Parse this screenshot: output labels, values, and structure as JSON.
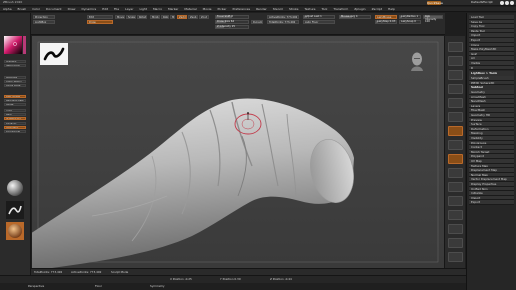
{
  "titlebar": {
    "app_title": "ZBrush 2020",
    "menus": [
      "Menus",
      "DefaultZScript"
    ],
    "quicksave": "QuickSave",
    "default_zscript": "DefaultZScript"
  },
  "menubar": {
    "items": [
      "Alpha",
      "Brush",
      "Color",
      "Document",
      "Draw",
      "Dynamics",
      "Edit",
      "File",
      "Layer",
      "Light",
      "Macro",
      "Marker",
      "Material",
      "Movie",
      "Picker",
      "Preferences",
      "Render",
      "Stencil",
      "Stroke",
      "Texture",
      "Tool",
      "Transform",
      "Zplugin",
      "Zscript",
      "Help"
    ]
  },
  "toolbar": {
    "projection": "Projection",
    "lightbox": "LightBox",
    "mrgb": "Mrgb",
    "rgb": "Rgb",
    "m": "M",
    "zadd": "Zadd",
    "zsub": "Zsub",
    "zcut": "Zcut",
    "focal_shift": "Focal Shift 0",
    "z_intensity": "Z Intensity 25",
    "draw_size": "Draw Size 64",
    "rgb_intensity": "Rgb Intensity 100",
    "dynamic": "Dynamic",
    "active_points": "ActivePoints: 773,492",
    "total_points": "TotalPoints: 773,492",
    "adjust_last": "Adjust Last 1",
    "auto_floor": "Auto Floor",
    "mouse_avg": "Mouse Avg 4",
    "lazy_mouse": "LazyMouse",
    "lazy_step": "LazyStep 0.03",
    "lazy_radius": "LazyRadius 1",
    "lazy_snap": "LazySnap 0",
    "edit": "Edit",
    "draw": "Draw",
    "move": "Move",
    "scale": "Scale",
    "rotate": "Rotate"
  },
  "leftshelf": {
    "labels": [
      "Alpha Off",
      "Texture Off",
      "Gradient",
      "SwitchColor",
      "Alternate",
      "Quick Sketch",
      "Curve Mode",
      "Lazy Mouse",
      "Backface Mask",
      "Xpose",
      "Front",
      "Back",
      "Sculptris Pro",
      "Dynamic",
      "Symmetry",
      "Edit Normal"
    ],
    "brush_label": "Standard",
    "stroke_label": "DragRect",
    "material_label": "MatCap Gray"
  },
  "rightnav": {
    "buttons": [
      "BPR",
      "SPix 3",
      "Scroll",
      "Zoom",
      "Actual",
      "AAHalf",
      "Persp",
      "Floor",
      "Local",
      "L.Sym",
      "Frame",
      "Move",
      "Zoom3D",
      "Rotate",
      "PolyF",
      "Transp",
      "Ghost",
      "Solo",
      "Xpose"
    ]
  },
  "tray": {
    "top_buttons": [
      "Load Tool",
      "Save As",
      "Copy Tool",
      "Paste Tool",
      "Import",
      "Export",
      "Clone",
      "Make PolyMesh3D",
      "GoZ",
      "All",
      "Visible",
      "R"
    ],
    "sections": [
      {
        "label": "Lightbox > Tools",
        "items": [
          "SimpleBrush",
          "PM3D_Sphere3D"
        ]
      },
      {
        "label": "Subtool",
        "items": [
          "Geometry",
          "ArrayMesh",
          "NanoMesh",
          "Layers",
          "FiberMesh",
          "Geometry HD",
          "Preview",
          "Surface",
          "Deformation",
          "Masking",
          "Visibility",
          "Polygroups",
          "Contact",
          "Morph Target",
          "Polypaint",
          "UV Map",
          "Texture Map",
          "Displacement Map",
          "Normal Map",
          "Vector Displacement Map",
          "Display Properties",
          "Unified Skin",
          "Initialize",
          "Import",
          "Export"
        ]
      }
    ],
    "highlighted": "Subtool",
    "lower": [
      "Geometry",
      "Lower Res",
      "Higher Res",
      "SDiv 5",
      "Del Lower",
      "Del Higher",
      "Freeze SubDivision Levels",
      "Reconstruct Subdiv",
      "Convert BPR To Geo",
      "Divide",
      "Smt",
      "Suv",
      "ReUV",
      "Edge Loop",
      "Crease",
      "ShadowBox",
      "ClayPolish",
      "DynaMesh",
      "Tessimate",
      "ZRemesher",
      "Modify Topology",
      "Position",
      "Size",
      "MeshIntegrity",
      "ArrayMesh",
      "NanoMesh",
      "Thick Skin",
      "Layers",
      "FiberMesh",
      "Geometry HD",
      "Preview",
      "Surface",
      "Deformation"
    ]
  },
  "bottom": {
    "row1": [
      "TotalPoints: 773,492",
      "ActivePoints: 773,492",
      "Sculpt Mode"
    ],
    "row2": [
      "X Position -0.25",
      "Y Position 0.39",
      "Z Position -0.44"
    ],
    "row3": [
      "Perspective",
      "Floor",
      "Symmetry"
    ],
    "labels": [
      "Polypaint",
      "Texture",
      "Alpha"
    ]
  },
  "colors": {
    "accent_orange": "#b9692a",
    "brush_ring": "#c23a4a",
    "viewport_bg": "#3f3f3f",
    "model_light": "#d2d2d2",
    "model_dark": "#6f6f6f"
  },
  "icons": [
    "color-picker-icon",
    "alpha-stroke-icon",
    "head-navigation-icon",
    "brush-icon",
    "stroke-icon",
    "material-icon"
  ]
}
